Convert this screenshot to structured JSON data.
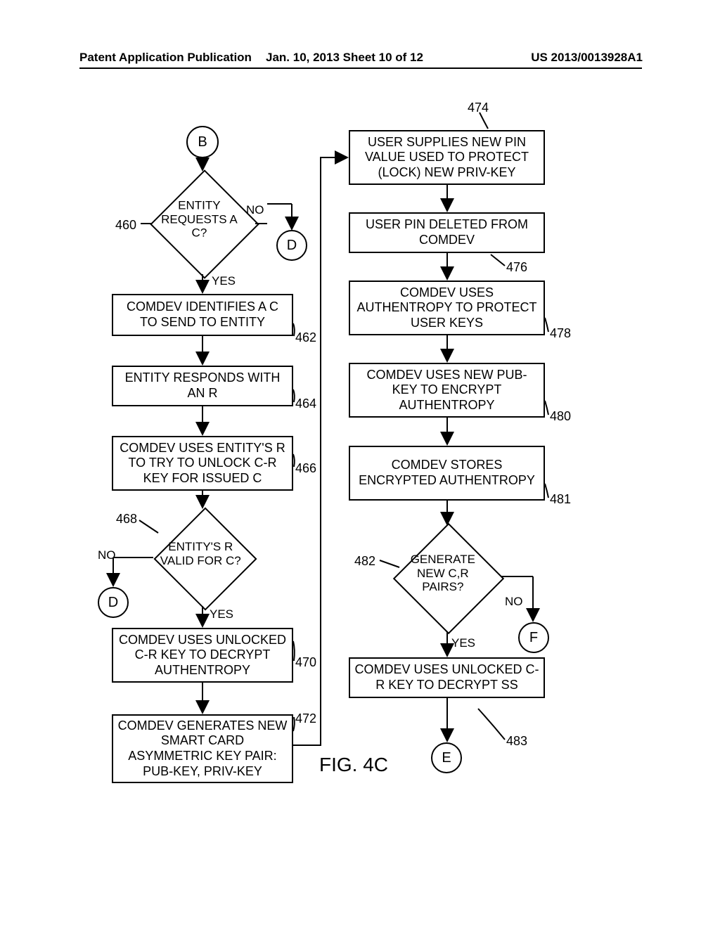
{
  "header": {
    "left": "Patent Application Publication",
    "mid": "Jan. 10, 2013  Sheet 10 of 12",
    "right": "US 2013/0013928A1"
  },
  "connectors": {
    "B": "B",
    "D1": "D",
    "D2": "D",
    "E": "E",
    "F": "F"
  },
  "left": {
    "dec460": "ENTITY REQUESTS A C?",
    "b462": "COMDEV IDENTIFIES A C TO SEND TO ENTITY",
    "b464": "ENTITY RESPONDS WITH AN R",
    "b466": "COMDEV USES ENTITY'S R TO TRY TO UNLOCK C-R KEY FOR ISSUED C",
    "dec468": "ENTITY'S R VALID FOR C?",
    "b470": "COMDEV USES UNLOCKED C-R KEY TO DECRYPT AUTHENTROPY",
    "b472": "COMDEV GENERATES NEW SMART CARD ASYMMETRIC KEY PAIR: PUB-KEY, PRIV-KEY"
  },
  "right": {
    "b474": "USER SUPPLIES NEW PIN VALUE USED TO PROTECT (LOCK) NEW PRIV-KEY",
    "b476": "USER PIN DELETED FROM COMDEV",
    "b478": "COMDEV USES AUTHENTROPY TO PROTECT USER KEYS",
    "b480": "COMDEV USES NEW PUB-KEY TO ENCRYPT AUTHENTROPY",
    "b481": "COMDEV STORES ENCRYPTED AUTHENTROPY",
    "dec482": "GENERATE NEW C,R PAIRS?",
    "b483": "COMDEV USES UNLOCKED C-R KEY TO DECRYPT SS"
  },
  "refs": {
    "r460": "460",
    "r462": "462",
    "r464": "464",
    "r466": "466",
    "r468": "468",
    "r470": "470",
    "r472": "472",
    "r474": "474",
    "r476": "476",
    "r478": "478",
    "r480": "480",
    "r481": "481",
    "r482": "482",
    "r483": "483"
  },
  "labels": {
    "yes": "YES",
    "no": "NO",
    "fig": "FIG. 4C"
  }
}
